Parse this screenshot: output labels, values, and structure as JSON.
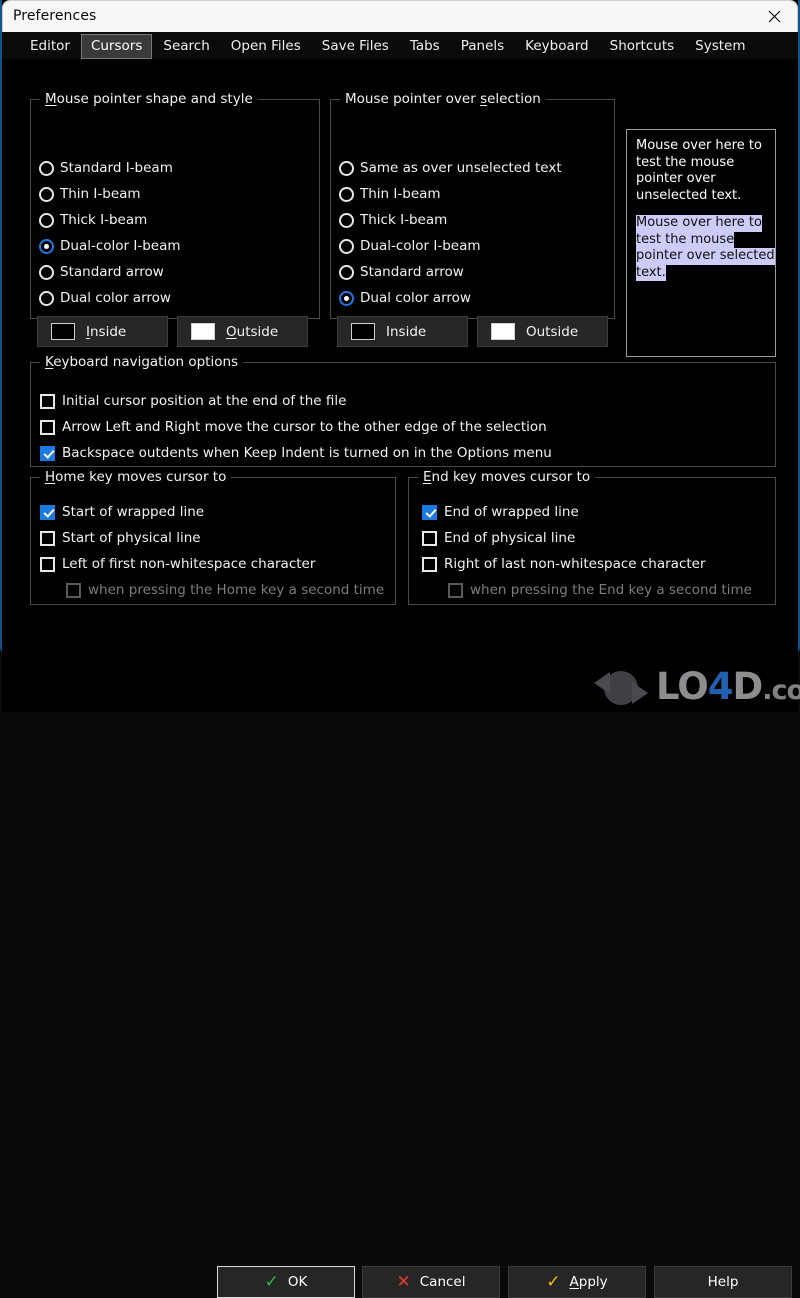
{
  "window": {
    "title": "Preferences",
    "close_icon": "close-icon"
  },
  "tabs": [
    {
      "label": "Editor",
      "active": false
    },
    {
      "label": "Cursors",
      "active": true
    },
    {
      "label": "Search",
      "active": false
    },
    {
      "label": "Open Files",
      "active": false
    },
    {
      "label": "Save Files",
      "active": false
    },
    {
      "label": "Tabs",
      "active": false
    },
    {
      "label": "Panels",
      "active": false
    },
    {
      "label": "Keyboard",
      "active": false
    },
    {
      "label": "Shortcuts",
      "active": false
    },
    {
      "label": "System",
      "active": false
    }
  ],
  "shape_group": {
    "title_pre": "M",
    "title_post": "ouse pointer shape and style",
    "options": [
      {
        "label": "Standard I-beam",
        "selected": false
      },
      {
        "label": "Thin I-beam",
        "selected": false
      },
      {
        "label": "Thick I-beam",
        "selected": false
      },
      {
        "label": "Dual-color I-beam",
        "selected": true
      },
      {
        "label": "Standard arrow",
        "selected": false
      },
      {
        "label": "Dual color arrow",
        "selected": false
      }
    ],
    "inside": {
      "label_pre": "I",
      "label_post": "nside",
      "color": "#000000"
    },
    "outside": {
      "label_pre": "O",
      "label_post": "utside",
      "color": "#ffffff"
    }
  },
  "selection_group": {
    "title_a": "Mouse pointer over ",
    "title_mn": "s",
    "title_b": "election",
    "options": [
      {
        "label": "Same as over unselected text",
        "selected": false
      },
      {
        "label": "Thin I-beam",
        "selected": false
      },
      {
        "label": "Thick I-beam",
        "selected": false
      },
      {
        "label": "Dual-color I-beam",
        "selected": false
      },
      {
        "label": "Standard arrow",
        "selected": false
      },
      {
        "label": "Dual color arrow",
        "selected": true
      }
    ],
    "inside": {
      "label": "Inside",
      "color": "#000000"
    },
    "outside": {
      "label": "Outside",
      "color": "#ffffff"
    }
  },
  "test_panel": {
    "unselected_lines": [
      "Mouse over here to",
      "test the mouse",
      "pointer over",
      "unselected text."
    ],
    "selected_lines": [
      "Mouse over here to",
      "test the mouse ",
      "pointer over selected",
      "text."
    ],
    "selection_color": "#ccccf8"
  },
  "keyboard_group": {
    "title_pre": "K",
    "title_post": "eyboard navigation options",
    "items": [
      {
        "label": "Initial cursor position at the end of the file",
        "checked": false,
        "disabled": false
      },
      {
        "label": "Arrow Left and Right move the cursor to the other edge of the selection",
        "checked": false,
        "disabled": false
      },
      {
        "label": "Backspace outdents when Keep Indent is turned on in the Options menu",
        "checked": true,
        "disabled": false
      }
    ]
  },
  "home_group": {
    "title_pre": "H",
    "title_post": "ome key moves cursor to",
    "items": [
      {
        "label": "Start of wrapped line",
        "checked": true,
        "disabled": false,
        "indent": false
      },
      {
        "label": "Start of physical line",
        "checked": false,
        "disabled": false,
        "indent": false
      },
      {
        "label": "Left of first non-whitespace character",
        "checked": false,
        "disabled": false,
        "indent": false
      },
      {
        "label": "when pressing the Home key a second time",
        "checked": false,
        "disabled": true,
        "indent": true
      }
    ]
  },
  "end_group": {
    "title_pre": "E",
    "title_post": "nd key moves cursor to",
    "items": [
      {
        "label": "End of wrapped line",
        "checked": true,
        "disabled": false,
        "indent": false
      },
      {
        "label": "End of physical line",
        "checked": false,
        "disabled": false,
        "indent": false
      },
      {
        "label": "Right of last non-whitespace character",
        "checked": false,
        "disabled": false,
        "indent": false
      },
      {
        "label": "when pressing the End key a second time",
        "checked": false,
        "disabled": true,
        "indent": true
      }
    ]
  },
  "buttons": {
    "ok": {
      "label": "OK",
      "icon": "check-icon",
      "color": "#2fb63d"
    },
    "cancel": {
      "label": "Cancel",
      "icon": "cross-icon",
      "color": "#e23d24"
    },
    "apply_pre": "A",
    "apply_post": "pply",
    "apply_icon": "check-icon",
    "apply_color": "#f5bc12",
    "help_label": "Help"
  },
  "watermark": {
    "lo": "LO",
    "four": "4",
    "d": "D",
    "com": ".com"
  }
}
